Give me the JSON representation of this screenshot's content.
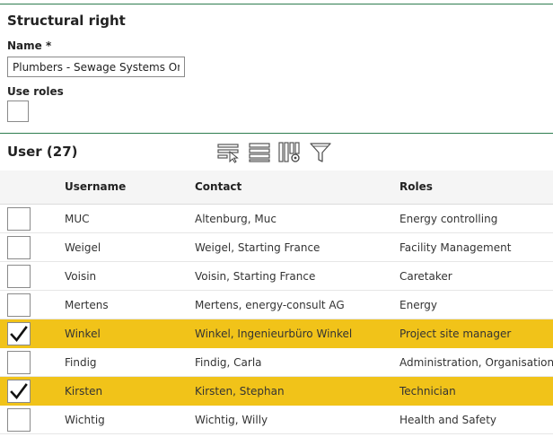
{
  "section": {
    "title": "Structural right"
  },
  "name_field": {
    "label": "Name *",
    "value": "Plumbers - Sewage Systems Only"
  },
  "use_roles": {
    "label": "Use roles",
    "checked": false
  },
  "users": {
    "title": "User (27)",
    "toolbar": [
      "select-rows-icon",
      "list-view-icon",
      "column-settings-icon",
      "filter-icon"
    ],
    "columns": {
      "username": "Username",
      "contact": "Contact",
      "roles": "Roles"
    },
    "rows": [
      {
        "username": "MUC",
        "contact": "Altenburg, Muc",
        "roles": "Energy controlling",
        "checked": false
      },
      {
        "username": "Weigel",
        "contact": "Weigel, Starting France",
        "roles": "Facility Management",
        "checked": false
      },
      {
        "username": "Voisin",
        "contact": "Voisin, Starting France",
        "roles": "Caretaker",
        "checked": false
      },
      {
        "username": "Mertens",
        "contact": "Mertens, energy-consult AG",
        "roles": "Energy",
        "checked": false
      },
      {
        "username": "Winkel",
        "contact": "Winkel, Ingenieurbüro Winkel",
        "roles": "Project site manager",
        "checked": true
      },
      {
        "username": "Findig",
        "contact": "Findig, Carla",
        "roles": "Administration, Organisation",
        "checked": false
      },
      {
        "username": "Kirsten",
        "contact": "Kirsten, Stephan",
        "roles": "Technician",
        "checked": true
      },
      {
        "username": "Wichtig",
        "contact": "Wichtig, Willy",
        "roles": "Health and Safety",
        "checked": false
      }
    ]
  },
  "colors": {
    "accent_rule": "#2e7d4f",
    "selected_row": "#f1c319"
  }
}
